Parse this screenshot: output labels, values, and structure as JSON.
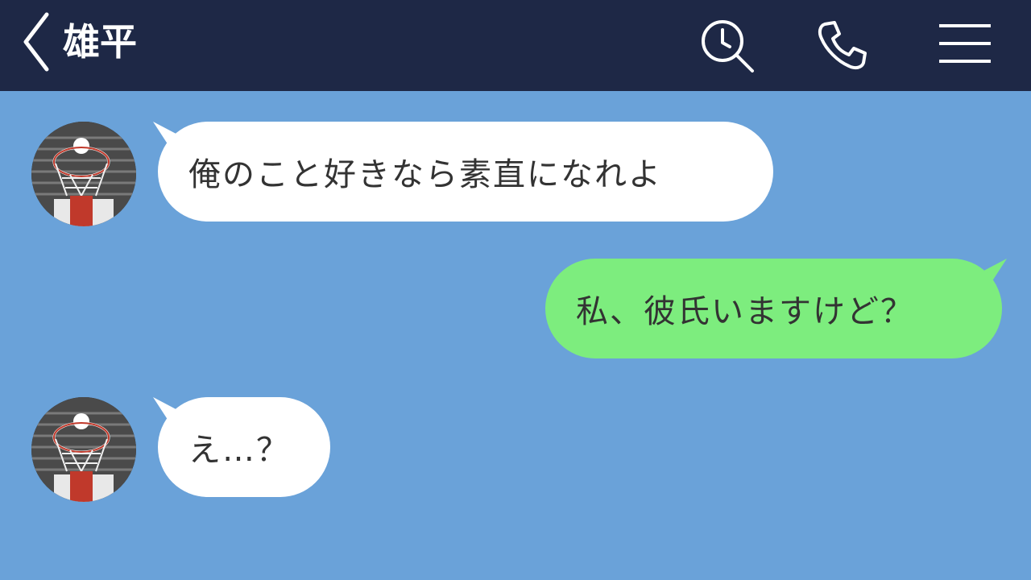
{
  "header": {
    "title": "雄平",
    "icons": [
      "chevron-left-icon",
      "search-clock-icon",
      "phone-icon",
      "hamburger-menu-icon"
    ],
    "background": "#1e2846"
  },
  "chat": {
    "background": "#6aa2d9",
    "messages": [
      {
        "sender": "other",
        "text": "俺のこと好きなら素直になれよ"
      },
      {
        "sender": "me",
        "text": "私、彼氏いますけど？"
      },
      {
        "sender": "other",
        "text": "え…？"
      }
    ],
    "colors": {
      "incoming_bubble": "#ffffff",
      "outgoing_bubble": "#7ded7e"
    }
  }
}
